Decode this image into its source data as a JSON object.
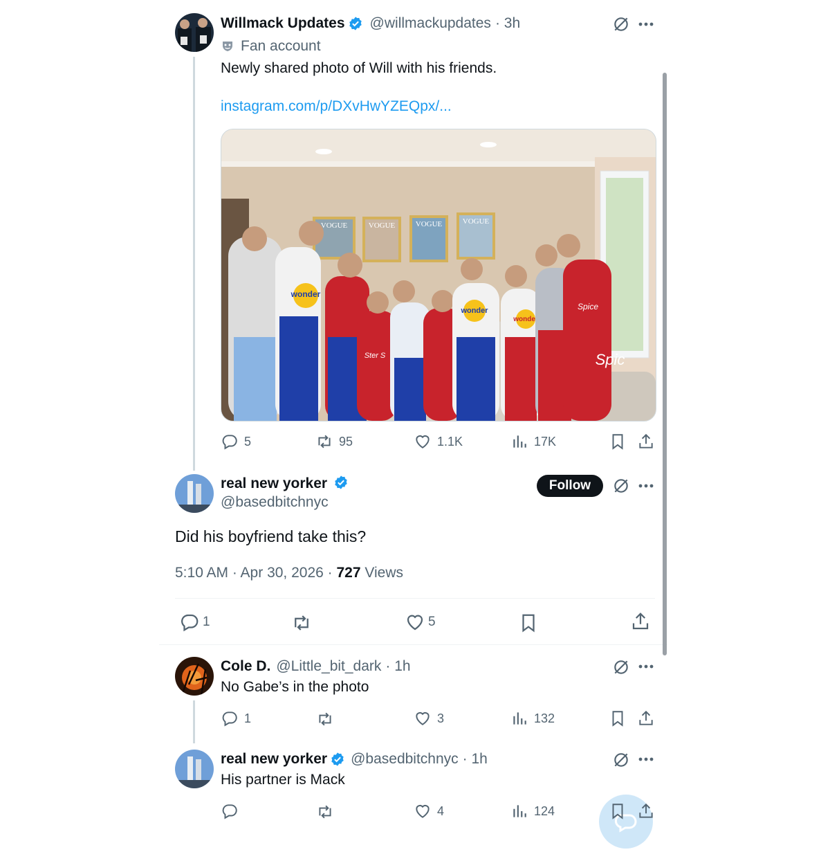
{
  "main_tweet": {
    "author_name": "Willmack Updates",
    "author_handle": "@willmackupdates",
    "time": "· 3h",
    "label": "Fan account",
    "text": "Newly shared photo of Will with his friends.",
    "link": "instagram.com/p/DXvHwYZEQpx/...",
    "photo_texts": [
      "VOGUE",
      "VOGUE",
      "VOGUE",
      "VOGUE",
      "wonder",
      "wonder",
      "wonder",
      "Spic",
      "Spice",
      "Ster S"
    ],
    "stats": {
      "replies": "5",
      "reposts": "95",
      "likes": "1.1K",
      "views": "17K"
    }
  },
  "focused_reply": {
    "author_name": "real new yorker",
    "author_handle": "@basedbitchnyc",
    "follow_label": "Follow",
    "text": "Did his boyfriend take this?",
    "time": "5:10 AM · Apr 30, 2026 · ",
    "views_count": "727",
    "views_label": " Views",
    "stats": {
      "replies": "1",
      "likes": "5"
    }
  },
  "replies": [
    {
      "author_name": "Cole D.",
      "author_handle": "@Little_bit_dark",
      "time": "· 1h",
      "text": "No Gabe’s in the photo",
      "stats": {
        "replies": "1",
        "likes": "3",
        "views": "132"
      }
    },
    {
      "author_name": "real new yorker",
      "author_handle": "@basedbitchnyc",
      "time": "· 1h",
      "text": "His partner is Mack",
      "stats": {
        "likes": "4",
        "views": "124"
      }
    }
  ],
  "colors": {
    "accent": "#1d9bf0",
    "text": "#0f1419",
    "muted": "#536471",
    "verified": "#1d9bf0",
    "divider": "#eff3f4"
  },
  "icons": [
    "verified-badge-icon",
    "fan-account-mask-icon",
    "grok-icon",
    "more-icon",
    "reply-icon",
    "repost-icon",
    "like-icon",
    "views-icon",
    "bookmark-icon",
    "share-icon",
    "compose-reply-icon"
  ]
}
